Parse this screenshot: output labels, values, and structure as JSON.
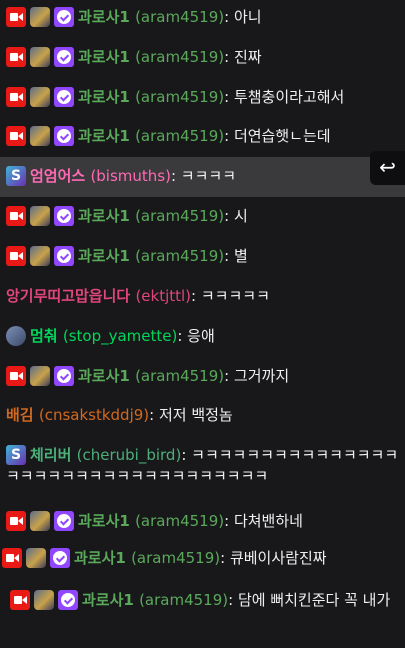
{
  "colors": {
    "background": "#18181b",
    "highlight": "#3a3a3d",
    "name_green": "#5aa95a",
    "name_pink": "#ff69b4",
    "name_red_pink": "#e0457b",
    "name_bright_green": "#00d65a",
    "name_orange": "#d2691e",
    "name_teal_green": "#4caf7a"
  },
  "back_button_icon": "return-arrow-icon",
  "messages": [
    {
      "name": "과로사1",
      "login": "(aram4519)",
      "text": "아니"
    },
    {
      "name": "과로사1",
      "login": "(aram4519)",
      "text": "진짜"
    },
    {
      "name": "과로사1",
      "login": "(aram4519)",
      "text": "투챔충이라고해서"
    },
    {
      "name": "과로사1",
      "login": "(aram4519)",
      "text": "더연습햇ㄴ는데"
    },
    {
      "name": "엄엄어스",
      "login": "(bismuths)",
      "text": "ㅋㅋㅋㅋ"
    },
    {
      "name": "과로사1",
      "login": "(aram4519)",
      "text": "시"
    },
    {
      "name": "과로사1",
      "login": "(aram4519)",
      "text": "별"
    },
    {
      "name": "앙기무띠고맙읍니다",
      "login": "(ektjttl)",
      "text": "ㅋㅋㅋㅋㅋ"
    },
    {
      "name": "멈춰",
      "login": "(stop_yamette)",
      "text": "응애"
    },
    {
      "name": "과로사1",
      "login": "(aram4519)",
      "text": "그거까지"
    },
    {
      "name": "배김",
      "login": "(cnsakstkddj9)",
      "text": "저저 백정놈"
    },
    {
      "name": "체리버",
      "login": "(cherubi_bird)",
      "text": "ㅋㅋㅋㅋㅋㅋㅋㅋㅋㅋㅋㅋㅋㅋㅋㅋㅋㅋㅋㅋㅋㅋㅋㅋㅋㅋㅋㅋㅋㅋㅋㅋㅋㅋ"
    },
    {
      "name": "과로사1",
      "login": "(aram4519)",
      "text": "다쳐밴하네"
    },
    {
      "name": "과로사1",
      "login": "(aram4519)",
      "text": "큐베이사람진짜"
    },
    {
      "name": "과로사1",
      "login": "(aram4519)",
      "text": "담에 뻐치킨준다 꼭 내가"
    }
  ]
}
